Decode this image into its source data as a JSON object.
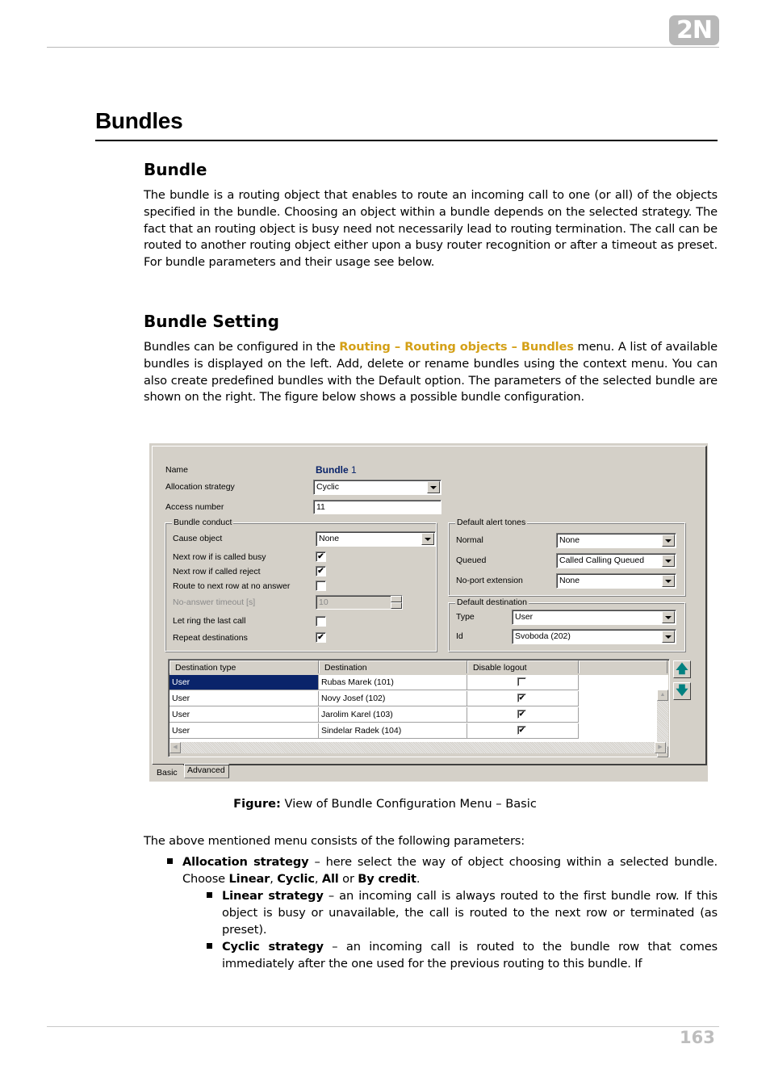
{
  "header": {
    "logo_text": "2N"
  },
  "title": "Bundles",
  "sections": {
    "bundle": {
      "heading": "Bundle",
      "paragraph": "The bundle is a routing object that enables to route an incoming call to one (or all) of the objects specified in the bundle. Choosing an object within a bundle depends on the selected strategy. The fact that an routing object is busy need not necessarily lead to routing termination. The call can be routed to another routing object either upon a busy router recognition or after a timeout as preset. For bundle parameters and their usage see below."
    },
    "bundle_setting": {
      "heading": "Bundle Setting",
      "para_before": "Bundles can be configured in the ",
      "menu_path": "Routing – Routing objects – Bundles",
      "para_after": " menu. A list of available bundles is displayed on the left. Add, delete or rename bundles using the context menu. You can also create predefined bundles with the Default option. The parameters of the selected bundle are shown on the right. The figure below shows a possible bundle configuration."
    }
  },
  "dialog": {
    "name_label": "Name",
    "name_bold": "Bundle",
    "name_num": " 1",
    "allocation_label": "Allocation strategy",
    "allocation_value": "Cyclic",
    "access_label": "Access number",
    "access_value": "11",
    "conduct": {
      "title": "Bundle conduct",
      "cause_label": "Cause object",
      "cause_value": "None",
      "next_busy_label": "Next row if is called busy",
      "next_busy_checked": true,
      "next_reject_label": "Next row if called reject",
      "next_reject_checked": true,
      "route_no_answer_label": "Route to next row at no answer",
      "route_no_answer_checked": false,
      "timeout_label": "No-answer timeout [s]",
      "timeout_value": "10",
      "let_ring_label": "Let ring the last call",
      "let_ring_checked": false,
      "repeat_label": "Repeat destinations",
      "repeat_checked": true
    },
    "alert_tones": {
      "title": "Default alert tones",
      "normal_label": "Normal",
      "normal_value": "None",
      "queued_label": "Queued",
      "queued_value": "Called Calling Queued",
      "noport_label": "No-port extension",
      "noport_value": "None"
    },
    "default_destination": {
      "title": "Default destination",
      "type_label": "Type",
      "type_value": "User",
      "id_label": "Id",
      "id_value": "Svoboda (202)"
    },
    "grid": {
      "columns": [
        "Destination type",
        "Destination",
        "Disable logout",
        ""
      ],
      "rows": [
        {
          "type": "User",
          "destination": "Rubas Marek (101)",
          "disable_logout": false,
          "selected": true
        },
        {
          "type": "User",
          "destination": "Novy Josef (102)",
          "disable_logout": true,
          "selected": false
        },
        {
          "type": "User",
          "destination": "Jarolim Karel (103)",
          "disable_logout": true,
          "selected": false
        },
        {
          "type": "User",
          "destination": "Sindelar Radek (104)",
          "disable_logout": true,
          "selected": false
        }
      ]
    },
    "move_up_icon": "arrow-up",
    "move_down_icon": "arrow-down",
    "tabs": [
      "Basic",
      "Advanced"
    ],
    "active_tab": "Basic",
    "check_glyph": "✔",
    "up_glyph": "🡅",
    "down_glyph": "🡇"
  },
  "caption": {
    "label": "Figure:",
    "text": " View of Bundle Configuration Menu – Basic"
  },
  "intro": "The above mentioned menu consists of the following parameters:",
  "bullets": {
    "allocation": {
      "term": "Allocation strategy",
      "text1": " – here select the way of object choosing within a selected bundle. Choose ",
      "opt1": "Linear",
      "sep1": ", ",
      "opt2": "Cyclic",
      "sep2": ", ",
      "opt3": "All",
      "sep3": " or ",
      "opt4": "By credit",
      "end": "."
    },
    "linear": {
      "term": "Linear strategy",
      "text": " – an incoming call is always routed to the first bundle row. If this object is busy or unavailable, the call is routed to the next row or terminated (as preset)."
    },
    "cyclic": {
      "term": "Cyclic strategy",
      "text": " – an incoming call is routed to the bundle row that comes immediately after the one used for the previous routing to this bundle. If"
    }
  },
  "page_number": "163"
}
